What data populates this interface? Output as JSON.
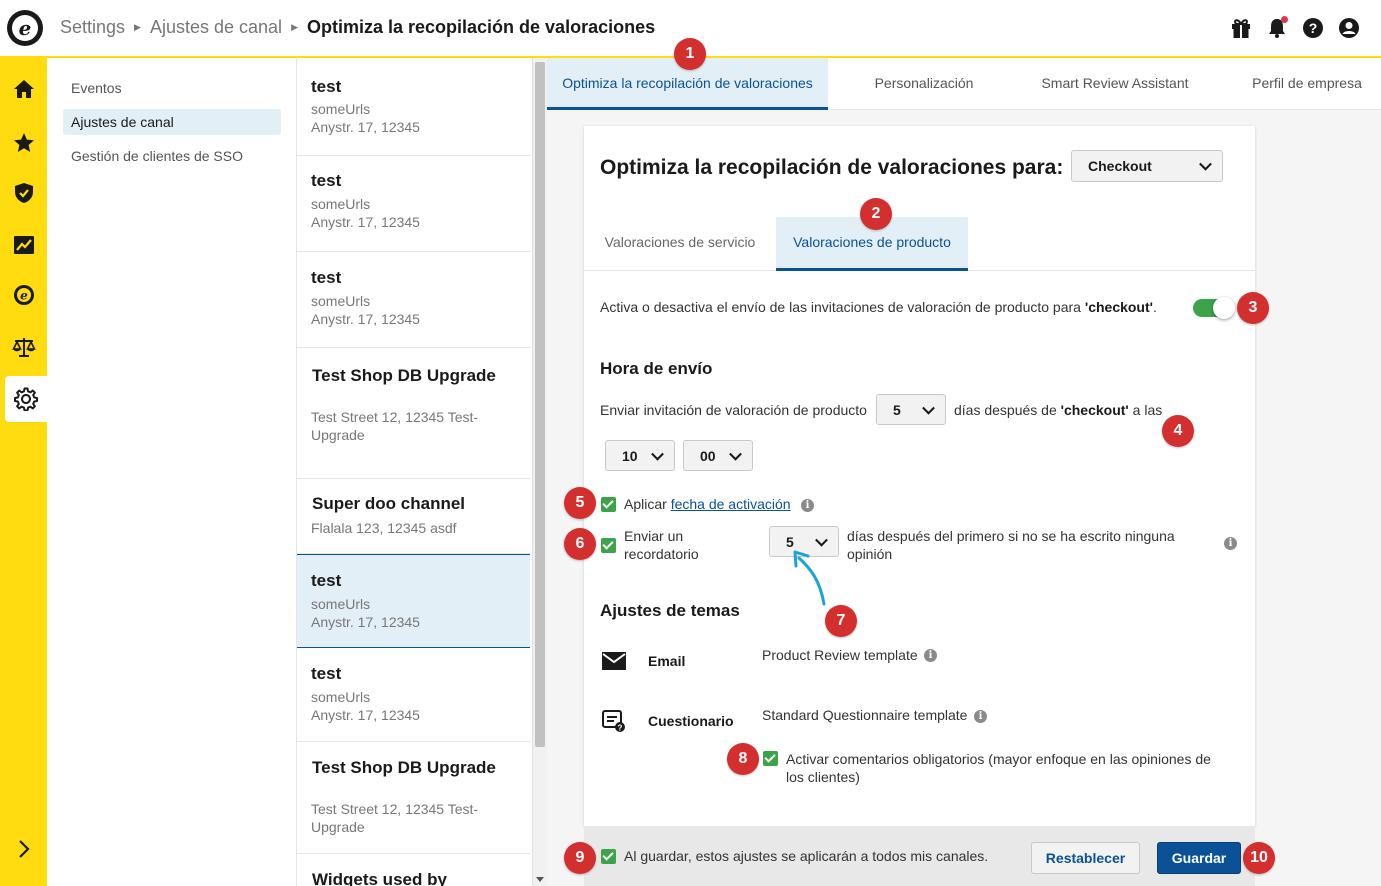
{
  "header": {
    "breadcrumbs": [
      "Settings",
      "Ajustes de canal"
    ],
    "current": "Optimiza la recopilación de valoraciones",
    "icons": [
      "gift-icon",
      "bell-icon",
      "help-icon",
      "user-icon"
    ]
  },
  "rail": {
    "items": [
      "home-icon",
      "star-icon",
      "shield-check-icon",
      "chart-icon",
      "trusted-icon",
      "scale-icon",
      "gear-icon"
    ],
    "active": "gear-icon",
    "expand_icon": "chevron-right-icon"
  },
  "nav": {
    "items": [
      "Eventos",
      "Ajustes de canal",
      "Gestión de clientes de SSO"
    ],
    "active_index": 1
  },
  "channels": [
    {
      "title": "test",
      "line1": "someUrls",
      "line2": "Anystr. 17, 12345"
    },
    {
      "title": "test",
      "line1": "someUrls",
      "line2": "Anystr. 17, 12345"
    },
    {
      "title": "test",
      "line1": "someUrls",
      "line2": "Anystr. 17, 12345"
    },
    {
      "title": "Test Shop DB Upgrade",
      "line1": "Test Street 12, 12345 Test-",
      "line2": "Upgrade"
    },
    {
      "title": "Super doo channel",
      "line1": "Flalala 123, 12345 asdf",
      "line2": ""
    },
    {
      "title": "test",
      "line1": "someUrls",
      "line2": "Anystr. 17, 12345"
    },
    {
      "title": "test",
      "line1": "someUrls",
      "line2": "Anystr. 17, 12345"
    },
    {
      "title": "Test Shop DB Upgrade",
      "line1": "Test Street 12, 12345 Test-",
      "line2": "Upgrade"
    },
    {
      "title": "Widgets used by",
      "line1": "",
      "line2": ""
    }
  ],
  "tabs": [
    "Optimiza la recopilación de valoraciones",
    "Personalización",
    "Smart Review Assistant",
    "Perfil de empresa"
  ],
  "card": {
    "title": "Optimiza la recopilación de valoraciones para:",
    "channel_select": "Checkout",
    "subtabs": [
      "Valoraciones de servicio",
      "Valoraciones de producto"
    ],
    "toggle_text_before": "Activa o desactiva el envío de las invitaciones de valoración de producto para ",
    "toggle_text_bold": "'checkout'",
    "toggle_text_after": ".",
    "toggle_on": true,
    "send_time_heading": "Hora de envío",
    "send_text_1": "Enviar invitación de valoración de producto",
    "days_value": "5",
    "send_text_2": "días después de ",
    "send_text_bold": "'checkout'",
    "send_text_3": " a las",
    "hour_value": "10",
    "minute_value": "00",
    "activation_label": "Aplicar ",
    "activation_link": "fecha de activación",
    "reminder_label_1": "Enviar un",
    "reminder_label_2": "recordatorio",
    "reminder_days": "5",
    "reminder_text_1": "días después del primero si no se ha escrito ninguna",
    "reminder_text_2": "opinión",
    "themes_heading": "Ajustes de temas",
    "email_label": "Email",
    "email_template": "Product Review template",
    "questionnaire_label": "Cuestionario",
    "questionnaire_template": "Standard Questionnaire template",
    "mandatory_text_1": "Activar comentarios obligatorios (mayor enfoque en las opiniones de",
    "mandatory_text_2": "los clientes)",
    "info_glyph": "i"
  },
  "footer": {
    "apply_all": "Al guardar, estos ajustes se aplicarán a todos mis canales.",
    "reset": "Restablecer",
    "save": "Guardar"
  },
  "badges": [
    "1",
    "2",
    "3",
    "4",
    "5",
    "6",
    "7",
    "8",
    "9",
    "10"
  ],
  "colors": {
    "accent": "#ffdc0f",
    "primary": "#0a5196",
    "badge": "#d32f2f",
    "check": "#3ba34a",
    "arrow": "#1aa3d9"
  }
}
